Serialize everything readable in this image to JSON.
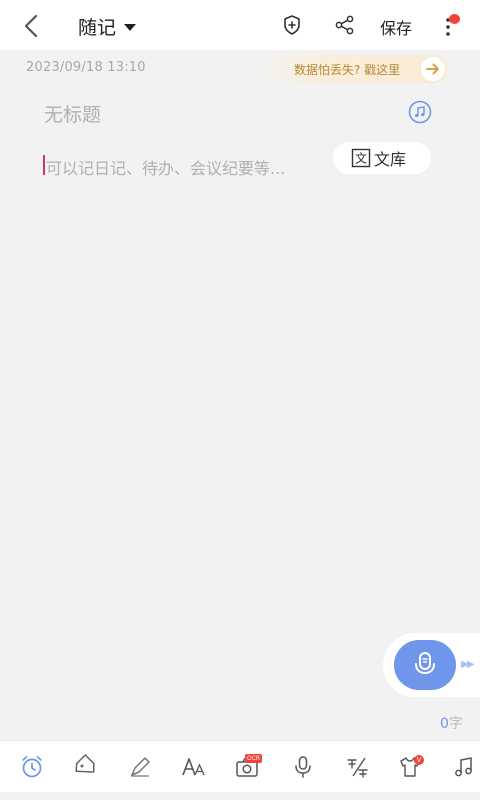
{
  "header": {
    "title": "随记",
    "save_label": "保存"
  },
  "note": {
    "datetime": "2023/09/18 13:10",
    "banner_text": "数据怕丢失? 戳这里",
    "title_placeholder": "无标题",
    "body_placeholder": "可以记日记、待办、会议纪要等...",
    "library_icon_text": "文",
    "library_label": "文库"
  },
  "footer": {
    "word_count": "0",
    "word_unit": "字",
    "ocr_badge": "OCR",
    "v_badge": "V"
  },
  "icons": {
    "back": "back-chevron-icon",
    "title_dropdown": "caret-down-icon",
    "add_tag": "shield-plus-icon",
    "share": "share-icon",
    "more": "more-vertical-icon",
    "banner_arrow": "arrow-right-icon",
    "music": "music-note-icon",
    "mic": "microphone-icon",
    "toolbar": [
      "alarm-clock-icon",
      "tag-icon",
      "pen-icon",
      "font-size-icon",
      "camera-ocr-icon",
      "microphone-icon",
      "text-format-icon",
      "shirt-theme-icon",
      "music-note-icon"
    ]
  },
  "colors": {
    "accent": "#6f96ea",
    "badge_red": "#f0443a",
    "banner_text": "#b9863a",
    "cursor": "#d6336c"
  }
}
